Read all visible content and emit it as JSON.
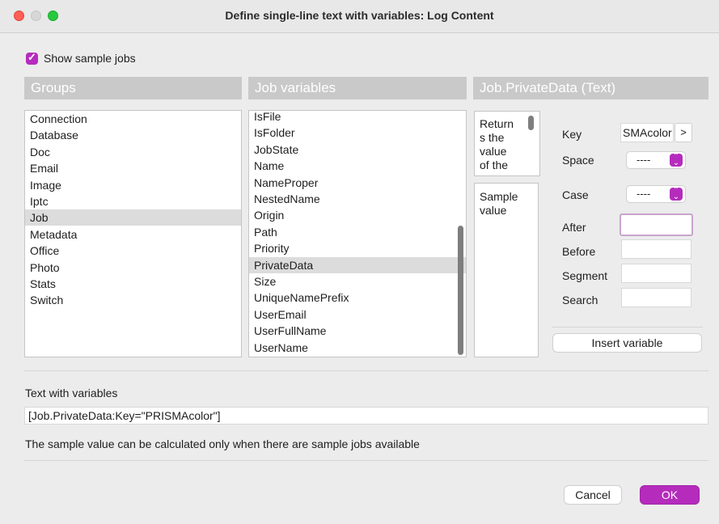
{
  "window": {
    "title": "Define single-line text with variables: Log Content"
  },
  "show_sample_jobs": {
    "label": "Show sample jobs",
    "checked": true
  },
  "groups": {
    "header": "Groups",
    "items": [
      "Connection",
      "Database",
      "Doc",
      "Email",
      "Image",
      "Iptc",
      "Job",
      "Metadata",
      "Office",
      "Photo",
      "Stats",
      "Switch"
    ],
    "selected": "Job"
  },
  "job_variables": {
    "header": "Job variables",
    "items": [
      "IsFile",
      "IsFolder",
      "JobState",
      "Name",
      "NameProper",
      "NestedName",
      "Origin",
      "Path",
      "Priority",
      "PrivateData",
      "Size",
      "UniqueNamePrefix",
      "UserEmail",
      "UserFullName",
      "UserName"
    ],
    "selected": "PrivateData"
  },
  "variable_detail": {
    "header": "Job.PrivateData (Text)",
    "description_lines": [
      "Return",
      "s the",
      "value",
      "of the"
    ],
    "sample_lines": [
      "Sample",
      "value"
    ],
    "key_label": "Key",
    "key_value": "SMAcolor",
    "key_button": ">",
    "space_label": "Space",
    "space_value": "----",
    "case_label": "Case",
    "case_value": "----",
    "after_label": "After",
    "before_label": "Before",
    "segment_label": "Segment",
    "search_label": "Search",
    "insert_button": "Insert variable"
  },
  "text_with_variables": {
    "label": "Text with variables",
    "value": "[Job.PrivateData:Key=\"PRISMAcolor\"]",
    "message": "The sample value can be calculated only when there are sample jobs available"
  },
  "buttons": {
    "cancel": "Cancel",
    "ok": "OK"
  },
  "colors": {
    "accent": "#b52cbc",
    "header_bg": "#c9c9c9",
    "window_bg": "#ececec"
  }
}
